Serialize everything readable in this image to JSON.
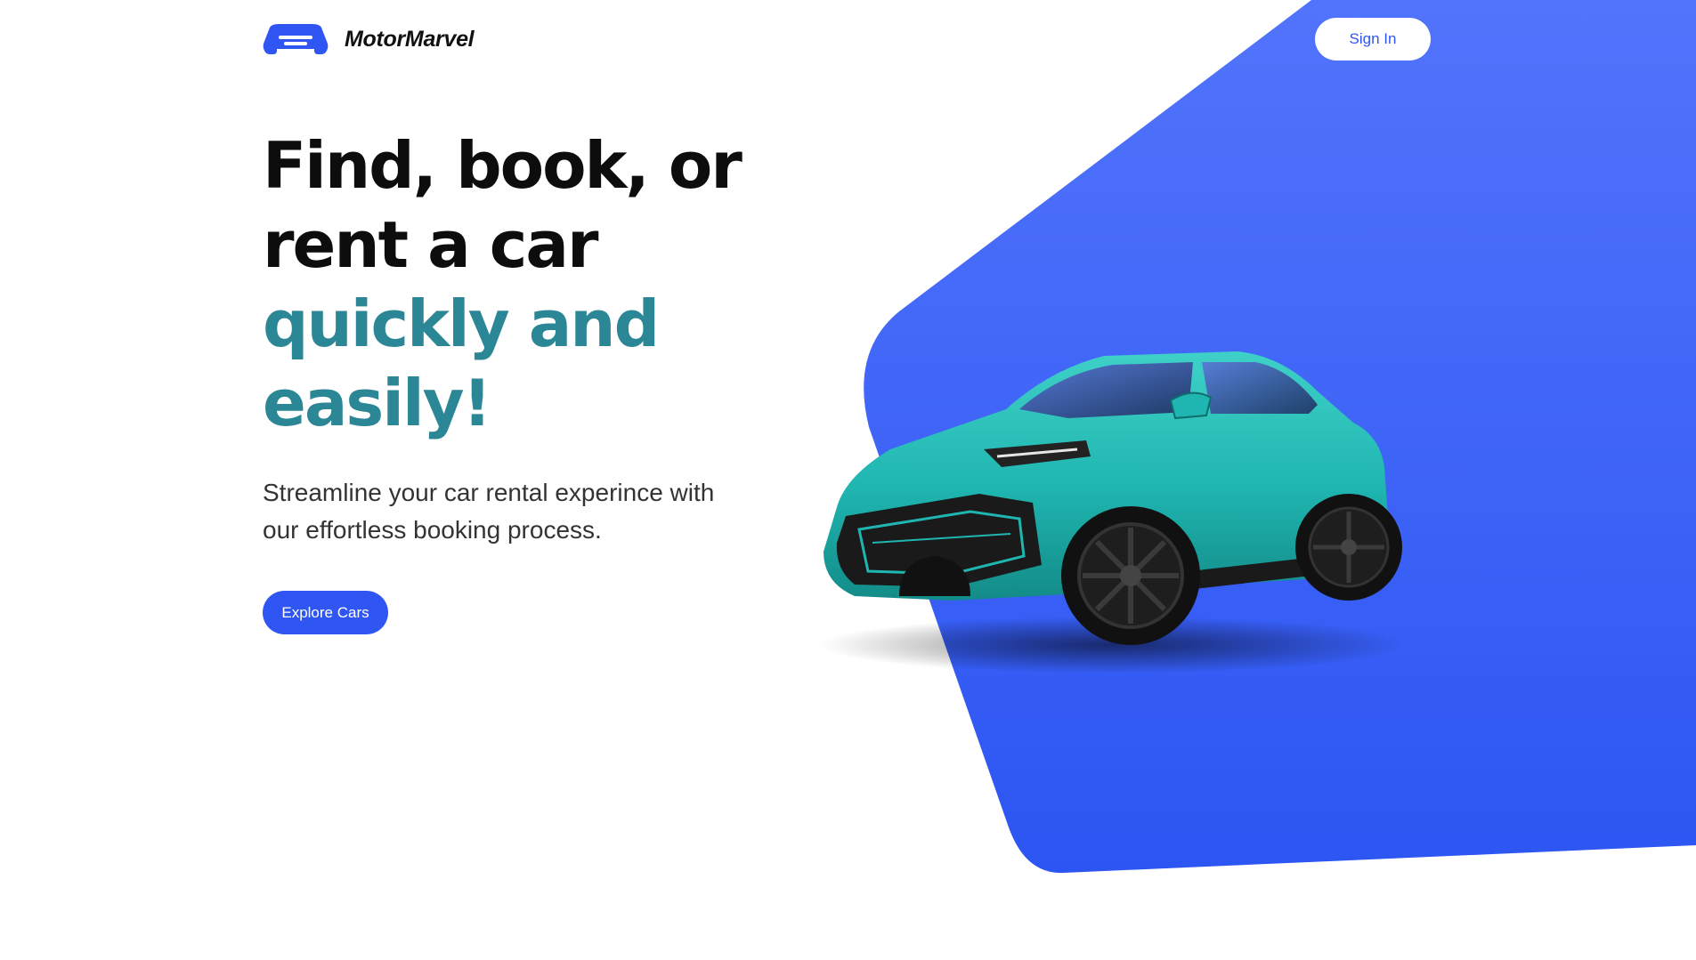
{
  "brand": {
    "name": "MotorMarvel",
    "logo_icon": "car-front-icon",
    "color": "#2f56f2"
  },
  "header": {
    "signin_label": "Sign In"
  },
  "hero": {
    "headline_line1": "Find, book, or",
    "headline_line2": "rent a car",
    "headline_line3": "quickly and",
    "headline_line4": "easily!",
    "subtitle": "Streamline your car rental experince with our effortless booking process.",
    "cta_label": "Explore Cars",
    "car_image": "teal-suv-car-image"
  },
  "colors": {
    "accent": "#2f56f2",
    "headline_dark": "#0d0d0d",
    "headline_teal": "#2b8796",
    "hero_blue_light": "#4f70fb",
    "hero_blue_dark": "#2e56f2",
    "car_teal": "#1fb5b0"
  }
}
